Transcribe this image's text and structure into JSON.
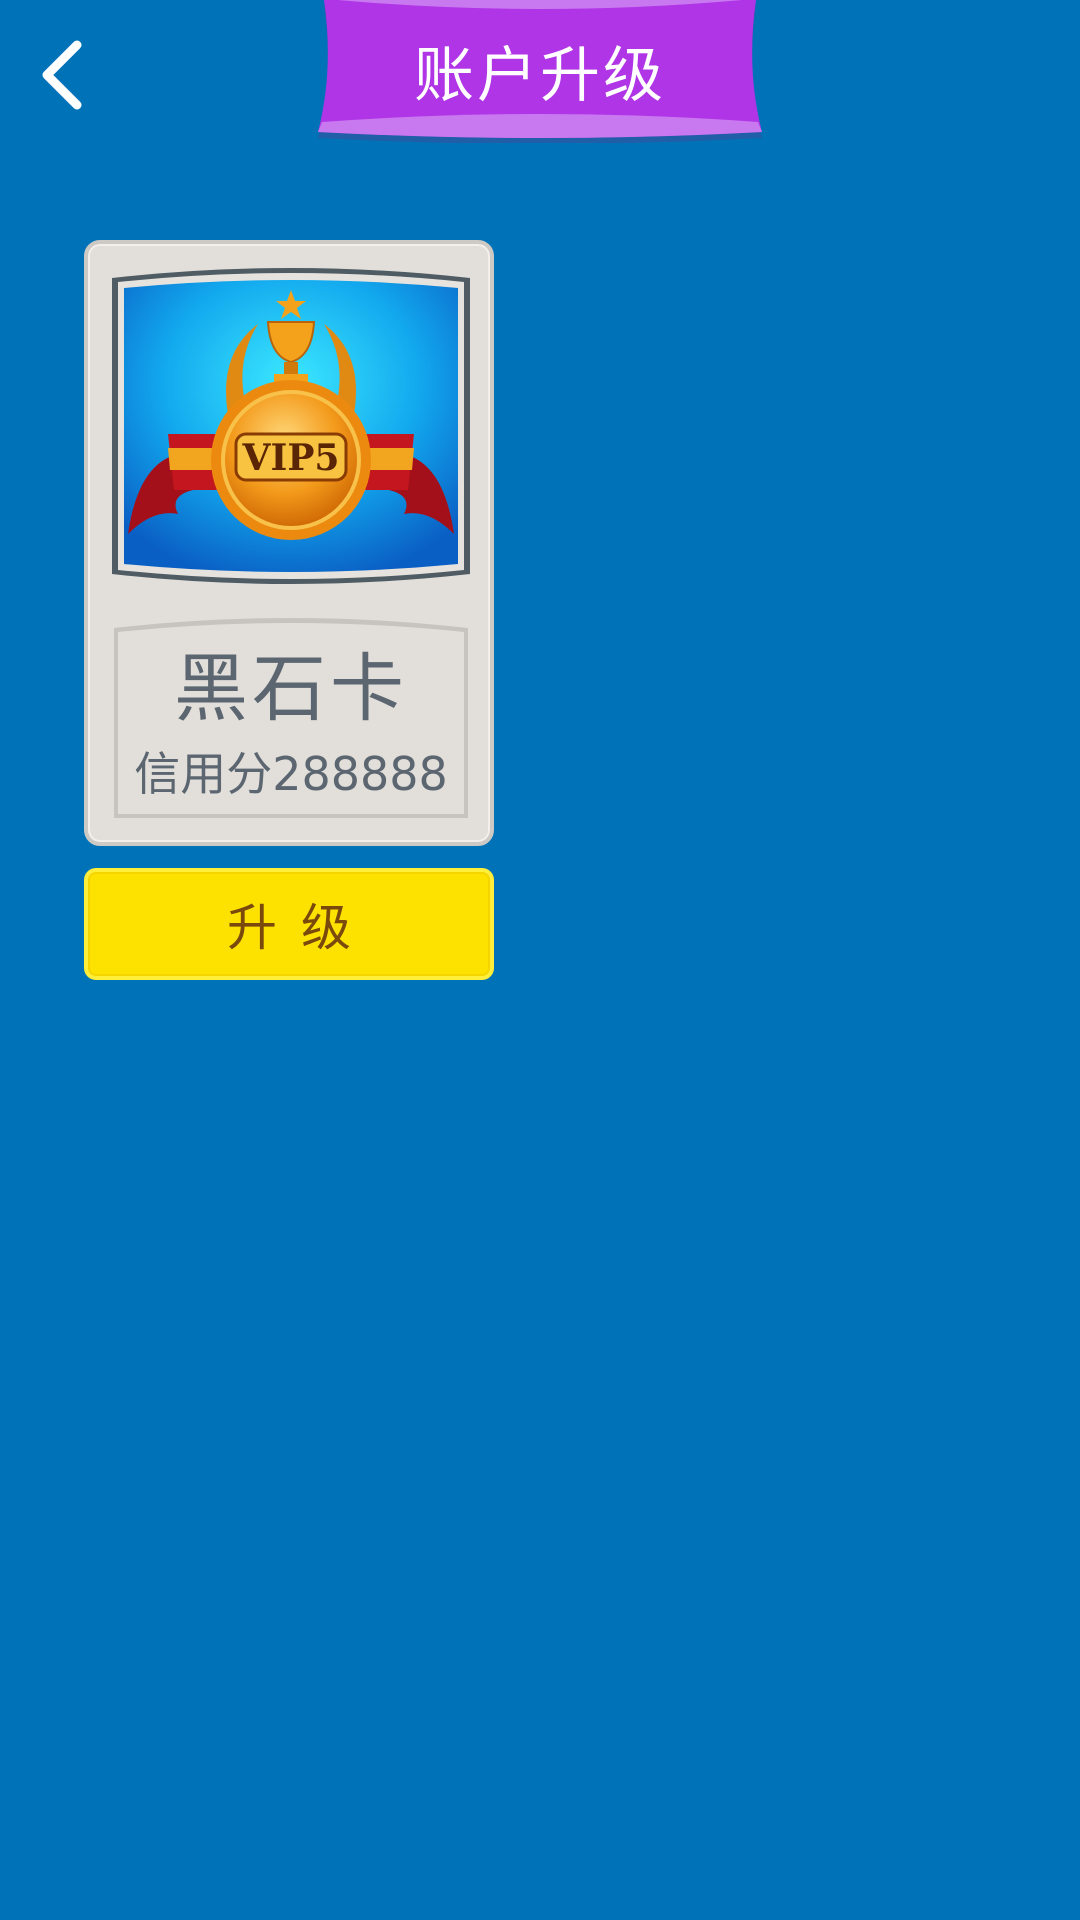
{
  "header": {
    "title": "账户升级",
    "back_icon": "chevron-left-icon"
  },
  "vip_card": {
    "badge_text": "VIP5",
    "badge_icon": "trophy-medal-icon",
    "name": "黑石卡",
    "credit": "信用分288888"
  },
  "actions": {
    "upgrade_label": "升级"
  },
  "colors": {
    "background": "#0073b8",
    "banner": "#b035e6",
    "card": "#e2dfdb",
    "button": "#fde200",
    "button_text": "#7a4a0c"
  }
}
